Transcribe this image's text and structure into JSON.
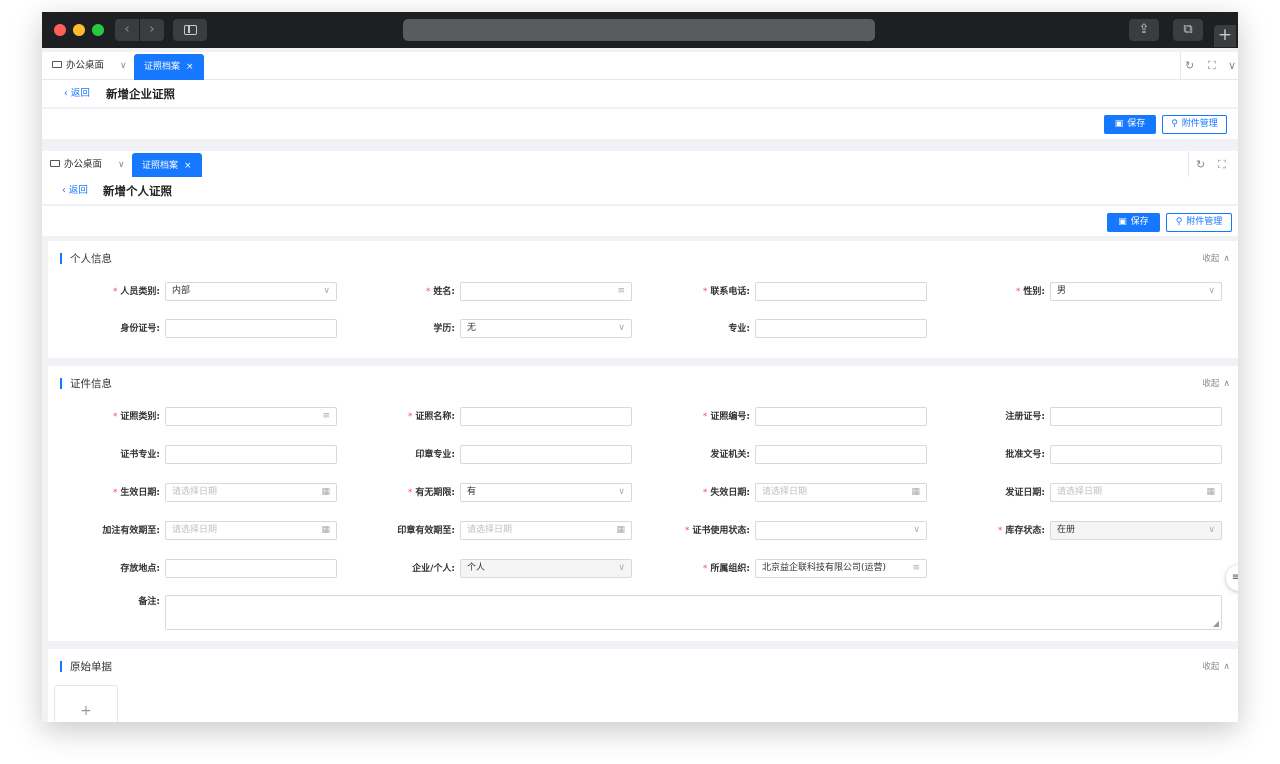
{
  "window": {
    "url": ""
  },
  "tabbar": {
    "home_label": "办公桌面",
    "active_tab": "证照档案",
    "close": "×"
  },
  "page1": {
    "back": "返回",
    "title": "新增企业证照"
  },
  "page2": {
    "back": "返回",
    "title": "新增个人证照"
  },
  "actions": {
    "save": "保存",
    "attachments": "附件管理"
  },
  "sections": {
    "personal": {
      "title": "个人信息",
      "collapse": "收起"
    },
    "certificate": {
      "title": "证件信息",
      "collapse": "收起"
    },
    "original": {
      "title": "原始单据",
      "collapse": "收起"
    }
  },
  "personal_fields": {
    "person_type": {
      "label": "人员类别:",
      "value": "内部"
    },
    "name": {
      "label": "姓名:",
      "value": ""
    },
    "phone": {
      "label": "联系电话:",
      "value": ""
    },
    "gender": {
      "label": "性别:",
      "value": "男"
    },
    "id_number": {
      "label": "身份证号:",
      "value": ""
    },
    "education": {
      "label": "学历:",
      "value": "无"
    },
    "major": {
      "label": "专业:",
      "value": ""
    }
  },
  "cert_fields": {
    "cert_type": {
      "label": "证照类别:",
      "value": ""
    },
    "cert_name": {
      "label": "证照名称:",
      "value": ""
    },
    "cert_no": {
      "label": "证照编号:",
      "value": ""
    },
    "reg_no": {
      "label": "注册证号:",
      "value": ""
    },
    "cert_major": {
      "label": "证书专业:",
      "value": ""
    },
    "seal_major": {
      "label": "印章专业:",
      "value": ""
    },
    "issuer": {
      "label": "发证机关:",
      "value": ""
    },
    "approval_no": {
      "label": "批准文号:",
      "value": ""
    },
    "effective_date": {
      "label": "生效日期:",
      "placeholder": "请选择日期"
    },
    "has_expiry": {
      "label": "有无期限:",
      "value": "有"
    },
    "expiry_date": {
      "label": "失效日期:",
      "placeholder": "请选择日期"
    },
    "issue_date": {
      "label": "发证日期:",
      "placeholder": "请选择日期"
    },
    "note_valid_to": {
      "label": "加注有效期至:",
      "placeholder": "请选择日期"
    },
    "seal_valid_to": {
      "label": "印章有效期至:",
      "placeholder": "请选择日期"
    },
    "usage_status": {
      "label": "证书使用状态:",
      "value": ""
    },
    "stock_status": {
      "label": "库存状态:",
      "value": "在册"
    },
    "storage_location": {
      "label": "存放地点:",
      "value": ""
    },
    "owner_type": {
      "label": "企业/个人:",
      "value": "个人"
    },
    "organization": {
      "label": "所属组织:",
      "value": "北京益企联科技有限公司(运营)"
    },
    "remarks": {
      "label": "备注:"
    }
  },
  "colors": {
    "primary": "#1677ff",
    "required": "#ff4d4f",
    "titlebar": "#1e1f22"
  }
}
